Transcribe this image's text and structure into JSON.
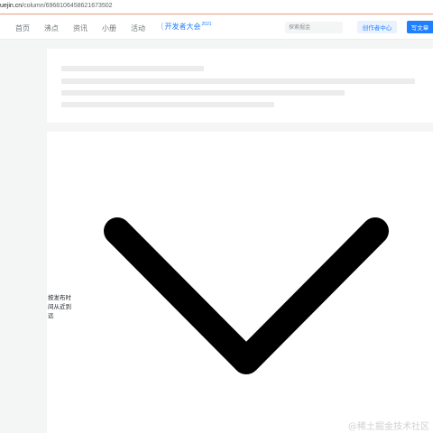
{
  "browser": {
    "url_host": "uejin.cn",
    "url_path": "/column/6968106458621673502"
  },
  "nav": {
    "items": [
      {
        "label": "首页",
        "name": "nav-item-home"
      },
      {
        "label": "沸点",
        "name": "nav-item-pins"
      },
      {
        "label": "资讯",
        "name": "nav-item-news"
      },
      {
        "label": "小册",
        "name": "nav-item-books"
      },
      {
        "label": "活动",
        "name": "nav-item-events"
      }
    ],
    "brand_label": "开发者大会",
    "brand_year": "2021",
    "search_placeholder": "探索掘金",
    "creator_label": "创作者中心",
    "write_label": "写文章"
  },
  "content": {
    "sort_label": "按发布时间从近到远"
  },
  "watermark": "@稀土掘金技术社区",
  "colors": {
    "accent": "#1e80ff",
    "accent_light": "#eaf2ff",
    "background": "#f4f5f5",
    "skeleton": "#ececec"
  },
  "icons": {
    "brand_mark": "brand-logo-icon",
    "sort_toggle": "chevron-down-icon"
  }
}
